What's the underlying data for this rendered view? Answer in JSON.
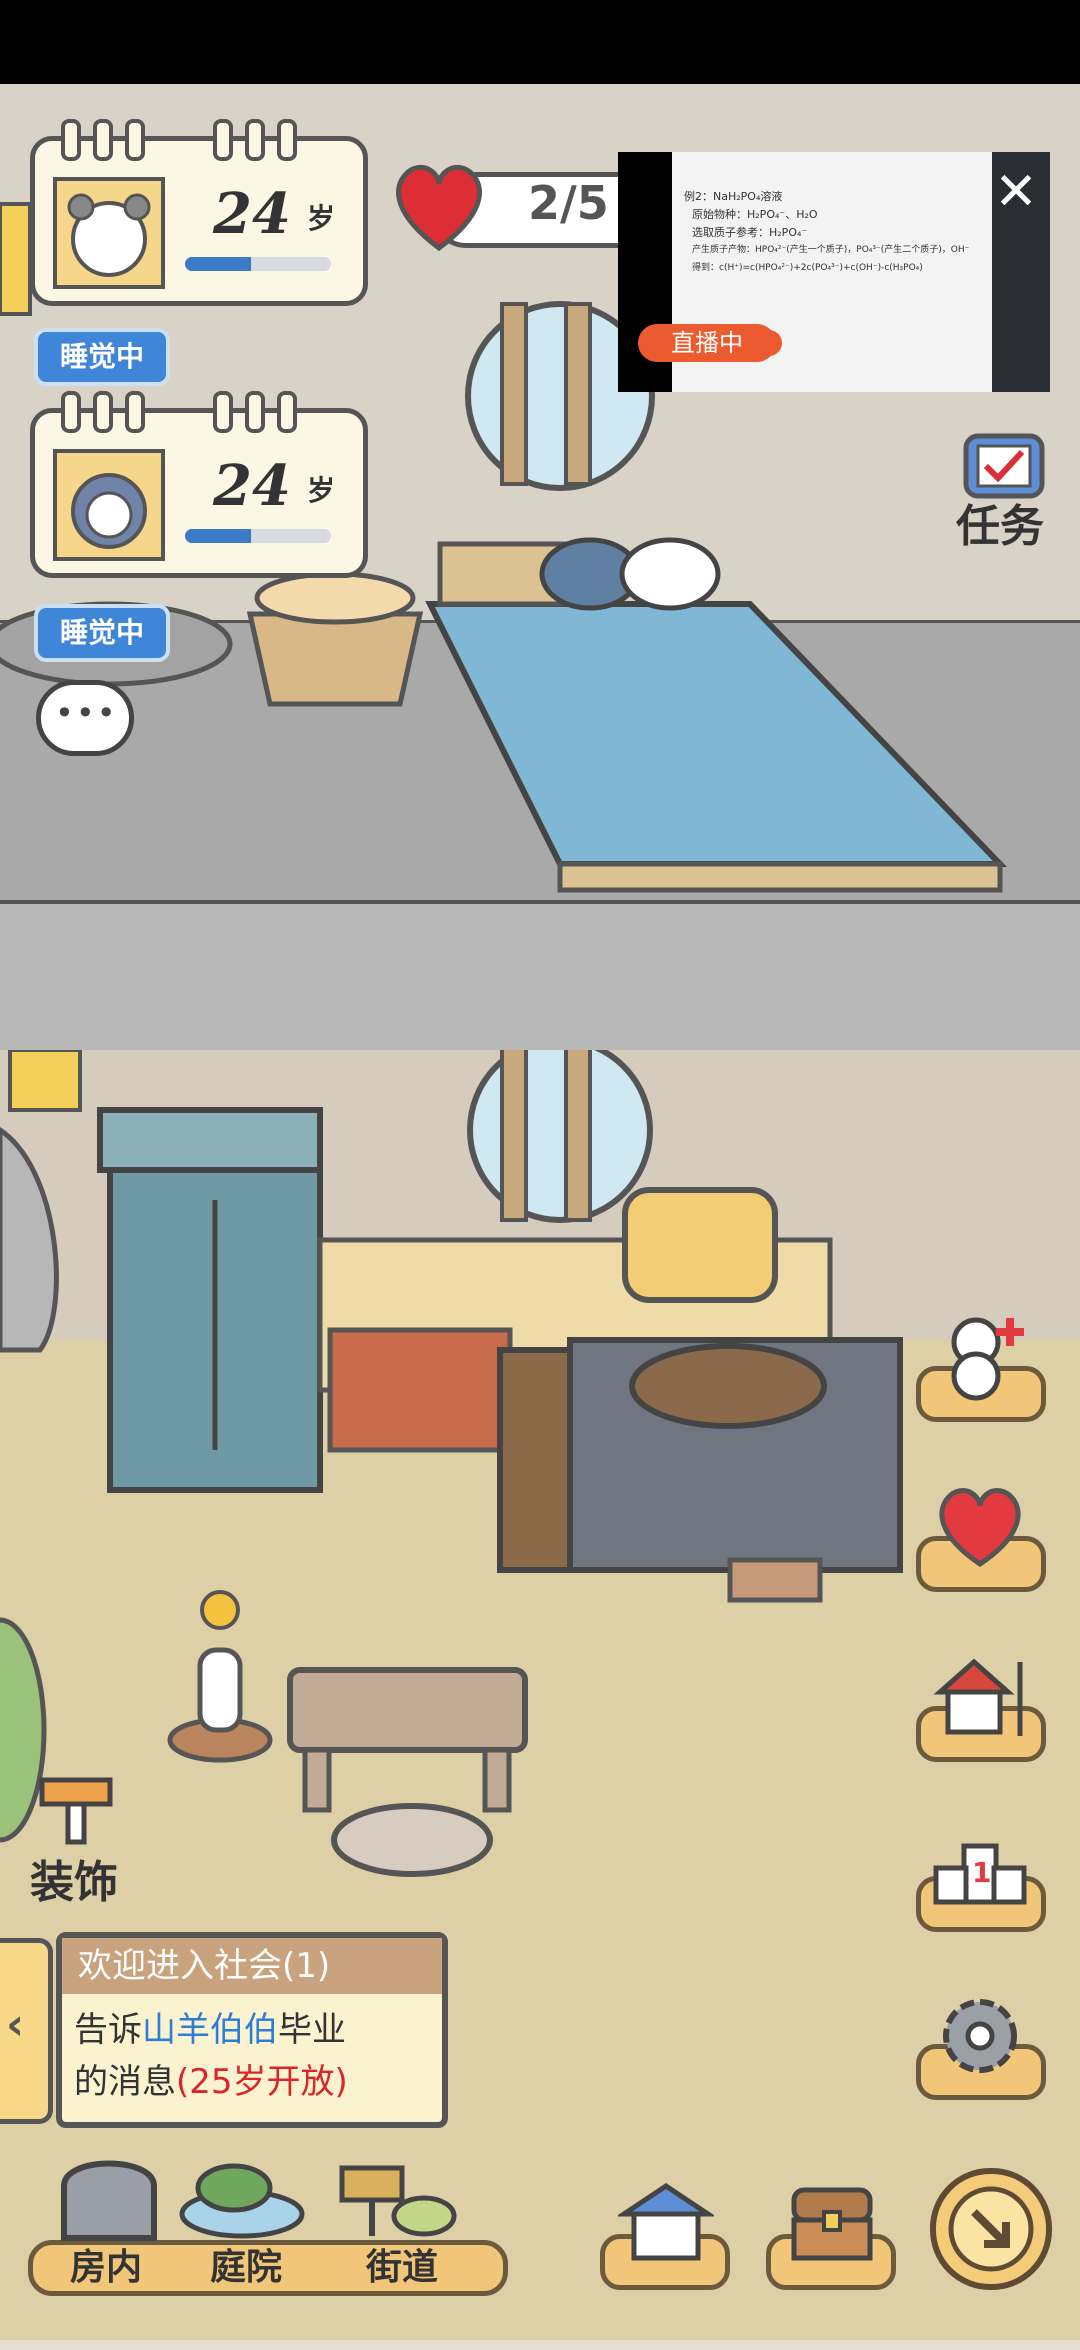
{
  "profiles": [
    {
      "age": "24",
      "age_unit": "岁",
      "status": "睡觉中",
      "progress": 0.45
    },
    {
      "age": "24",
      "age_unit": "岁",
      "status": "睡觉中",
      "progress": 0.45
    }
  ],
  "chat": {
    "label": "•••"
  },
  "hearts": {
    "count": "2/5"
  },
  "live_stream": {
    "badge": "直播中",
    "close": "✕",
    "screen_lines": [
      "例2：NaH₂PO₄溶液",
      "原始物种：H₂PO₄⁻、H₂O",
      "选取质子参考：H₂PO₄⁻",
      "产生质子产物：HPO₄²⁻(产生一个质子)，PO₄³⁻(产生二个质子)，OH⁻",
      "得到：c(H⁺)=c(HPO₄²⁻)+2c(PO₄³⁻)+c(OH⁻)-c(H₃PO₄)"
    ]
  },
  "right_menu": {
    "task_label": "任务"
  },
  "decorate": {
    "label": "装饰"
  },
  "quest": {
    "collapse_icon": "‹",
    "title": "欢迎进入社会(1)",
    "line1_prefix": "告诉",
    "line1_highlight": "山羊伯伯",
    "line1_suffix": "毕业",
    "line2_prefix": "的消息",
    "line2_highlight": "(25岁开放)"
  },
  "bottom_nav": {
    "items": [
      "房内",
      "庭院",
      "街道"
    ]
  },
  "colors": {
    "sleep_badge": "#3f86d8",
    "progress_fill": "#3d79c9",
    "live_badge": "#ec5b2f",
    "quest_highlight_blue": "#2f7dd8",
    "quest_highlight_red": "#d8262c"
  }
}
